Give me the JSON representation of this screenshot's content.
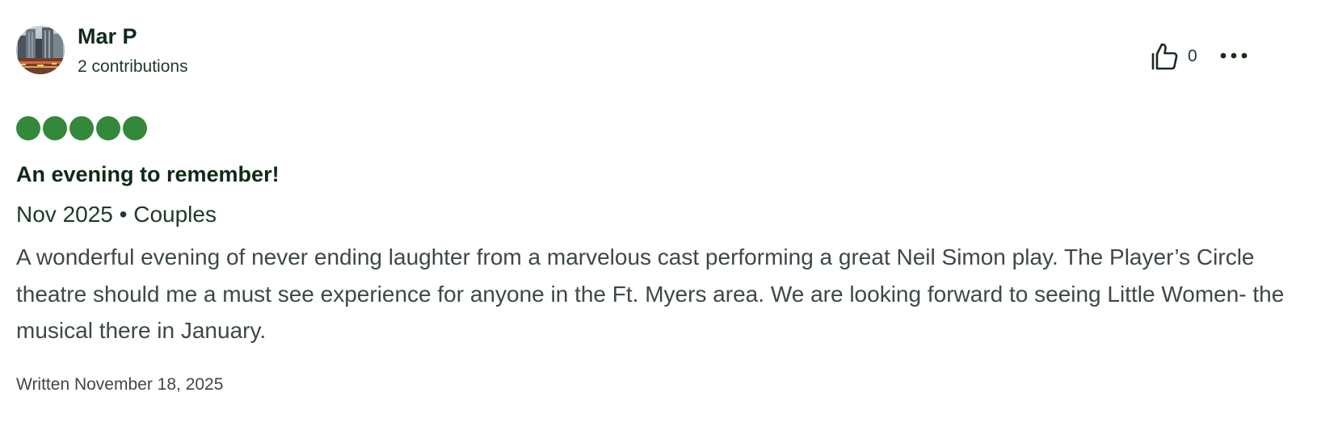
{
  "review": {
    "user": {
      "name": "Mar P",
      "contributions": "2 contributions",
      "avatar_icon": "cityscape-avatar"
    },
    "helpful": {
      "icon": "thumbs-up-icon",
      "count": "0"
    },
    "more_icon": "ellipsis-icon",
    "rating": {
      "value": 5,
      "max": 5,
      "color": "#34883b"
    },
    "title": "An evening to remember!",
    "trip_info": "Nov 2025 • Couples",
    "body": "A wonderful evening of never ending laughter from a marvelous cast performing a great Neil Simon play. The Player’s Circle theatre should me a must see experience for anyone in the Ft. Myers area. We are looking forward to seeing Little Women- the musical there in January.",
    "written_date": "Written November 18, 2025"
  }
}
